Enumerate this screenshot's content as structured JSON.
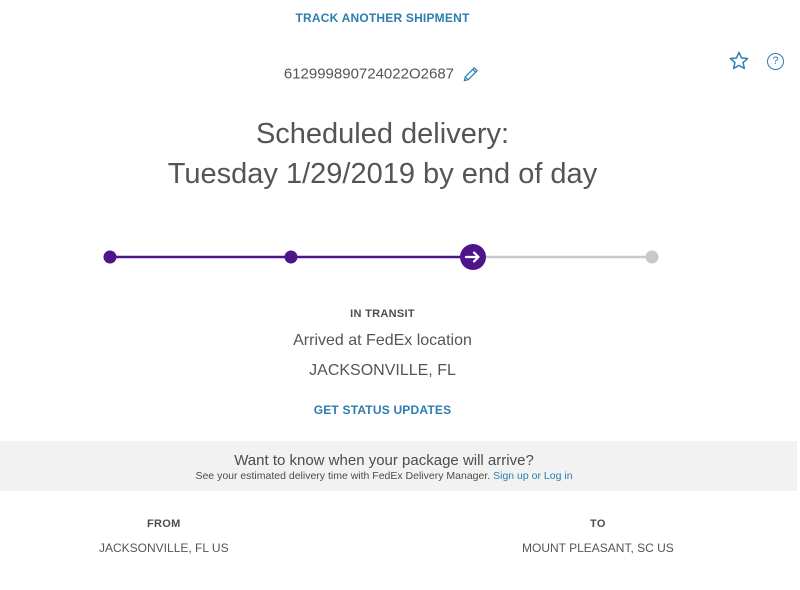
{
  "header": {
    "track_another": "TRACK ANOTHER SHIPMENT",
    "tracking_number": "612999890724022O2687"
  },
  "icons": {
    "star": "star-icon",
    "help": "help-icon",
    "edit": "pencil-icon",
    "help_glyph": "?"
  },
  "delivery": {
    "line1": "Scheduled delivery:",
    "line2": "Tuesday 1/29/2019 by end of day"
  },
  "progress": {
    "steps_total": 4,
    "current_step": 3,
    "completed_color": "#4d148c",
    "pending_color": "#c8c8c8"
  },
  "status": {
    "label": "IN TRANSIT",
    "description": "Arrived at FedEx location",
    "location": "JACKSONVILLE, FL",
    "get_updates": "GET STATUS UPDATES"
  },
  "banner": {
    "title": "Want to know when your package will arrive?",
    "subtitle": "See your estimated delivery time with FedEx Delivery Manager.",
    "link_signup": "Sign up",
    "link_or": "or",
    "link_login": "Log in"
  },
  "route": {
    "from_label": "FROM",
    "from_value": "JACKSONVILLE, FL US",
    "to_label": "TO",
    "to_value": "MOUNT PLEASANT, SC US"
  },
  "colors": {
    "link": "#2b7eae",
    "brand_purple": "#4d148c",
    "banner_bg": "#f2f2f2"
  }
}
